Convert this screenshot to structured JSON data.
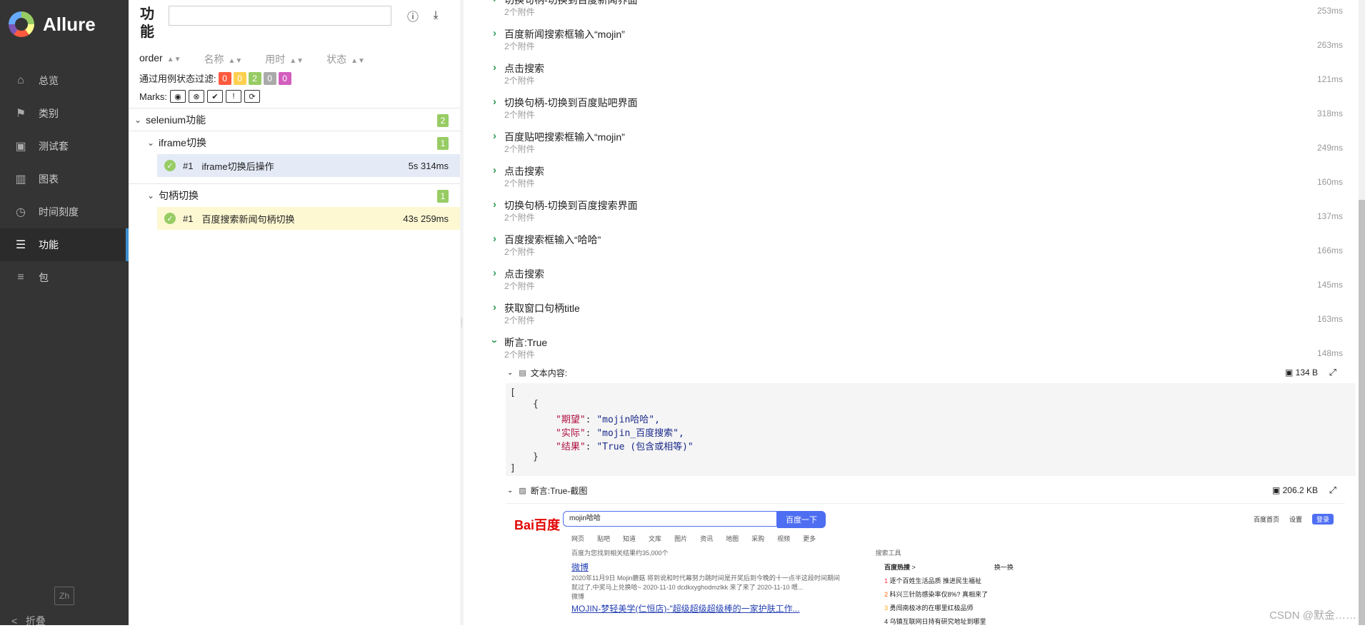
{
  "sidebar": {
    "brand": "Allure",
    "items": [
      {
        "label": "总览",
        "icon": "home-icon"
      },
      {
        "label": "类别",
        "icon": "flag-icon"
      },
      {
        "label": "测试套",
        "icon": "briefcase-icon"
      },
      {
        "label": "图表",
        "icon": "bar-chart-icon"
      },
      {
        "label": "时间刻度",
        "icon": "clock-icon"
      },
      {
        "label": "功能",
        "icon": "list-icon",
        "active": true
      },
      {
        "label": "包",
        "icon": "align-left-icon"
      }
    ],
    "lang": "Zh",
    "collapse": "折叠"
  },
  "tree": {
    "title": "功能",
    "search_value": "",
    "sort": [
      "order",
      "名称",
      "用时",
      "状态"
    ],
    "filter_label": "通过用例状态过滤:",
    "filter_counts": [
      {
        "value": "0",
        "color": "#fd5a3e"
      },
      {
        "value": "0",
        "color": "#ffd050"
      },
      {
        "value": "2",
        "color": "#97cc64"
      },
      {
        "value": "0",
        "color": "#aaaaaa"
      },
      {
        "value": "0",
        "color": "#d35ebe"
      }
    ],
    "marks_label": "Marks:",
    "root": {
      "label": "selenium功能",
      "count": "2"
    },
    "groups": [
      {
        "label": "iframe切换",
        "count": "1",
        "test": {
          "num": "#1",
          "name": "iframe切换后操作",
          "duration": "5s 314ms"
        }
      },
      {
        "label": "句柄切换",
        "count": "1",
        "test": {
          "num": "#1",
          "name": "百度搜索新闻句柄切换",
          "duration": "43s 259ms"
        }
      }
    ]
  },
  "steps": [
    {
      "name": "切换句柄-切换到百度新闻界面",
      "sub": "2个附件",
      "time": "253ms"
    },
    {
      "name": "百度新闻搜索框输入“mojin”",
      "sub": "2个附件",
      "time": "263ms"
    },
    {
      "name": "点击搜索",
      "sub": "2个附件",
      "time": "121ms"
    },
    {
      "name": "切换句柄-切换到百度贴吧界面",
      "sub": "2个附件",
      "time": "318ms"
    },
    {
      "name": "百度贴吧搜索框输入“mojin”",
      "sub": "2个附件",
      "time": "249ms"
    },
    {
      "name": "点击搜索",
      "sub": "2个附件",
      "time": "160ms"
    },
    {
      "name": "切换句柄-切换到百度搜索界面",
      "sub": "2个附件",
      "time": "137ms"
    },
    {
      "name": "百度搜索框输入“哈哈”",
      "sub": "2个附件",
      "time": "166ms"
    },
    {
      "name": "点击搜索",
      "sub": "2个附件",
      "time": "145ms"
    },
    {
      "name": "获取窗口句柄title",
      "sub": "2个附件",
      "time": "163ms"
    },
    {
      "name": "断言:True",
      "sub": "2个附件",
      "time": "148ms"
    }
  ],
  "attachments": {
    "text": {
      "title": "文本内容:",
      "size": "134 B"
    },
    "json": {
      "open": "[",
      "obj_open": "{",
      "lines": [
        {
          "key": "\"期望\"",
          "value": "\"mojin哈哈\","
        },
        {
          "key": "\"实际\"",
          "value": "\"mojin_百度搜索\","
        },
        {
          "key": "\"结果\"",
          "value": "\"True (包含或相等)\""
        }
      ],
      "obj_close": "}",
      "close": "]"
    },
    "image": {
      "title": "断言:True-截图",
      "size": "206.2 KB"
    }
  },
  "screenshot": {
    "logo": "Bai百度",
    "query": "mojin哈哈",
    "button": "百度一下",
    "tabs": [
      "网页",
      "贴吧",
      "知道",
      "文库",
      "图片",
      "资讯",
      "地图",
      "采购",
      "视频",
      "更多"
    ],
    "right_links": [
      "百度首页",
      "设置"
    ],
    "login": "登录",
    "result_count": "百度为您找到相关结果约35,000个",
    "tools": "搜索工具",
    "result1_title": "微博",
    "result1_line1": "2020年11月9日 Mojin蘑菇 将到说和时代幕努力跳时间是开奖后到今晚的十一点半这段时间期间",
    "result1_line2": "就过了,中奖马上兑换哈~ 2020-11-10 dcdkxyghodmzlkk 来了来了 2020-11-10 嗯...",
    "result1_line3": "微博",
    "result2_title": "MOJIN-梦轻美学(仁恒店)-\"超级超级超级棒的一家护肤工作...",
    "hot_title": "百度热搜",
    "hot_refresh": "换一换",
    "hot_items": [
      "逐个百姓生活品质 推进民生福祉",
      "科兴三针防感染率仅8%? 真相来了",
      "勇闯南极冰的在哪里红极品师",
      "乌镇互联网日持有研究地址到哪里"
    ]
  },
  "watermark": "CSDN @默金……"
}
